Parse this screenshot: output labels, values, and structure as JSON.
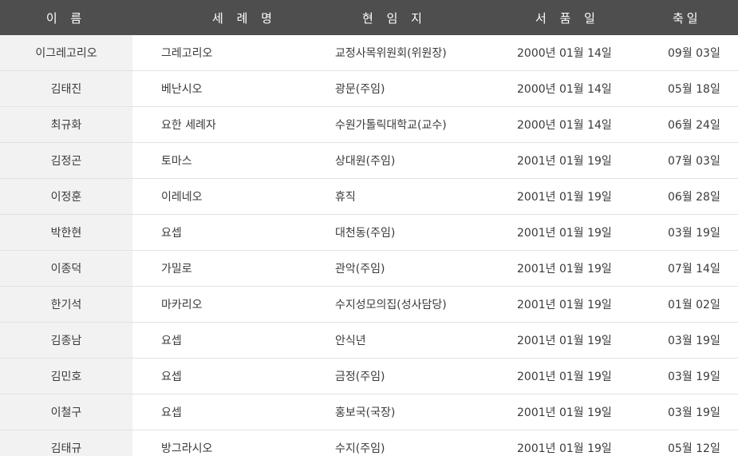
{
  "table": {
    "headers": {
      "name": "이 름",
      "baptismal": "세 례 명",
      "post": "현 임 지",
      "ordination": "서 품 일",
      "feast": "축일"
    },
    "rows": [
      {
        "name": "이그레고리오",
        "baptismal": "그레고리오",
        "post": "교정사목위원회(위원장)",
        "ordination": "2000년 01월 14일",
        "feast": "09월 03일"
      },
      {
        "name": "김태진",
        "baptismal": "베난시오",
        "post": "광문(주임)",
        "ordination": "2000년 01월 14일",
        "feast": "05월 18일"
      },
      {
        "name": "최규화",
        "baptismal": "요한 세례자",
        "post": "수원가톨릭대학교(교수)",
        "ordination": "2000년 01월 14일",
        "feast": "06월 24일"
      },
      {
        "name": "김정곤",
        "baptismal": "토마스",
        "post": "상대원(주임)",
        "ordination": "2001년 01월 19일",
        "feast": "07월 03일"
      },
      {
        "name": "이정훈",
        "baptismal": "이레네오",
        "post": "휴직",
        "ordination": "2001년 01월 19일",
        "feast": "06월 28일"
      },
      {
        "name": "박한현",
        "baptismal": "요셉",
        "post": "대천동(주임)",
        "ordination": "2001년 01월 19일",
        "feast": "03월 19일"
      },
      {
        "name": "이종덕",
        "baptismal": "가밀로",
        "post": "관악(주임)",
        "ordination": "2001년 01월 19일",
        "feast": "07월 14일"
      },
      {
        "name": "한기석",
        "baptismal": "마카리오",
        "post": "수지성모의집(성사담당)",
        "ordination": "2001년 01월 19일",
        "feast": "01월 02일"
      },
      {
        "name": "김종남",
        "baptismal": "요셉",
        "post": "안식년",
        "ordination": "2001년 01월 19일",
        "feast": "03월 19일"
      },
      {
        "name": "김민호",
        "baptismal": "요셉",
        "post": "금정(주임)",
        "ordination": "2001년 01월 19일",
        "feast": "03월 19일"
      },
      {
        "name": "이철구",
        "baptismal": "요셉",
        "post": "홍보국(국장)",
        "ordination": "2001년 01월 19일",
        "feast": "03월 19일"
      },
      {
        "name": "김태규",
        "baptismal": "방그라시오",
        "post": "수지(주임)",
        "ordination": "2001년 01월 19일",
        "feast": "05월 12일"
      }
    ]
  }
}
